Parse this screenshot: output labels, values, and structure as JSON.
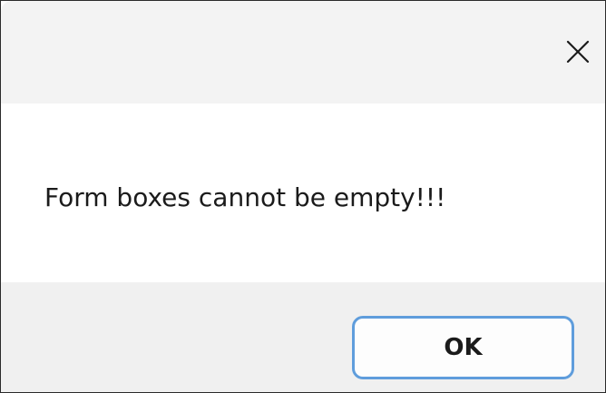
{
  "titlebar": {
    "close_icon": "close-icon"
  },
  "dialog": {
    "message": "Form boxes cannot be empty!!!"
  },
  "footer": {
    "ok_label": "OK"
  },
  "colors": {
    "accent_border": "#5f9ddc",
    "titlebar_bg": "#f3f3f3",
    "footer_bg": "#f0f0f0"
  }
}
